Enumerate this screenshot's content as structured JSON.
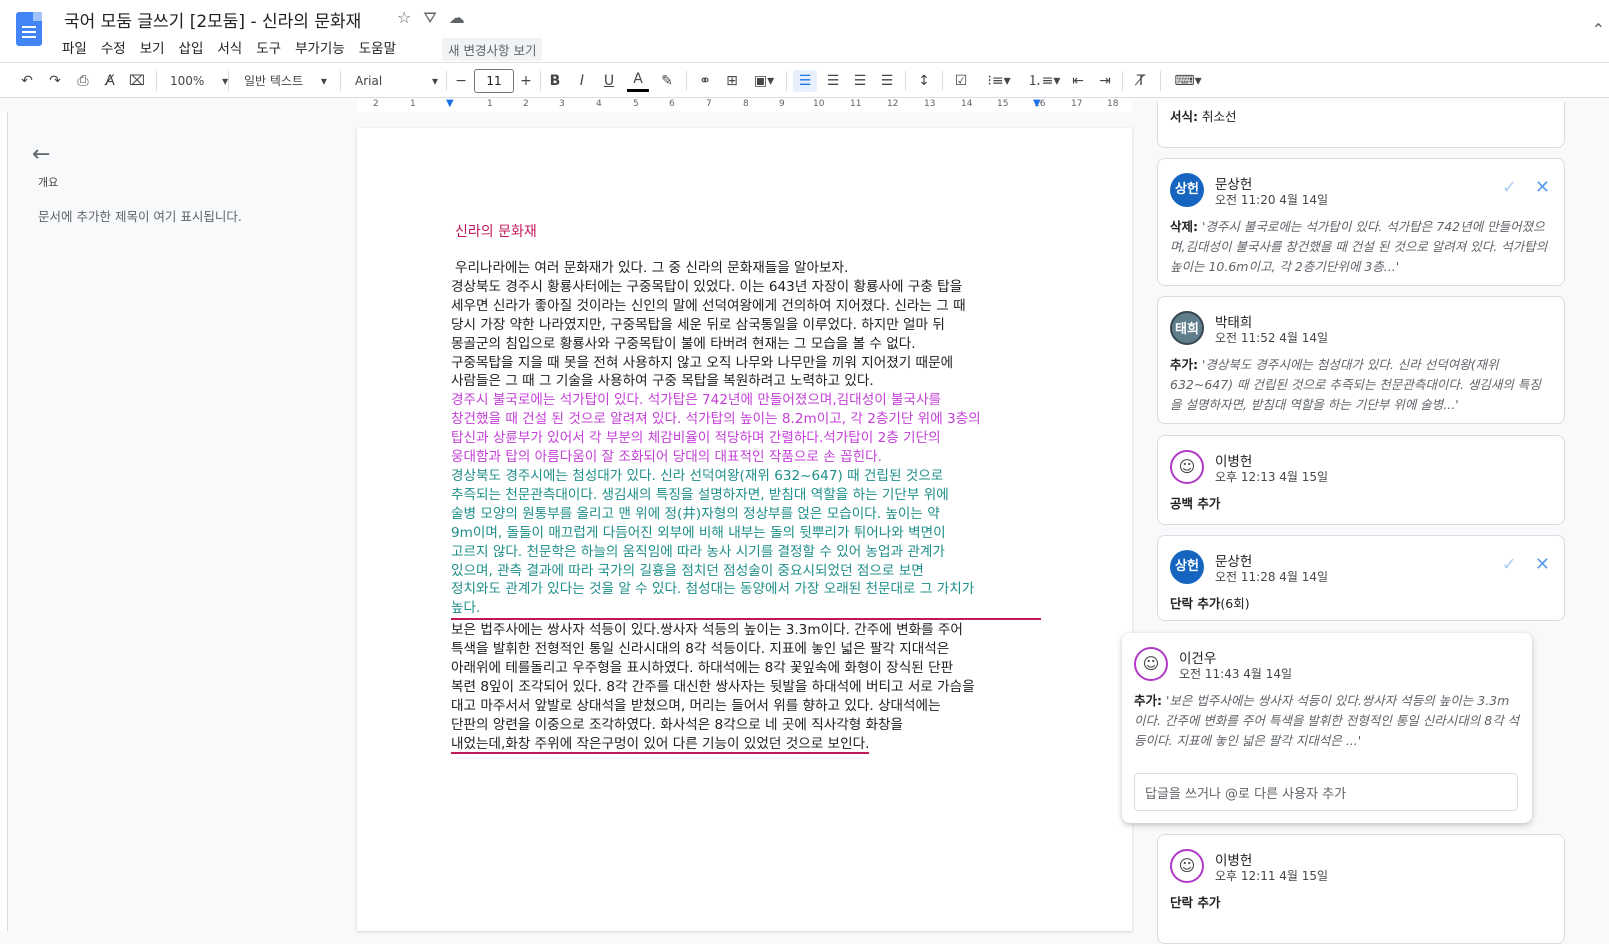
{
  "app": {
    "title": "국어 모둠 글쓰기 [2모둠] - 신라의 문화재",
    "menu": [
      "파일",
      "수정",
      "보기",
      "삽입",
      "서식",
      "도구",
      "부가기능",
      "도움말"
    ],
    "changes_button": "새 변경사항 보기"
  },
  "toolbar": {
    "zoom": "100%",
    "style": "일반 텍스트",
    "font": "Arial",
    "font_size": "11",
    "minus": "−",
    "plus": "+"
  },
  "ruler": [
    "2",
    "1",
    "1",
    "2",
    "3",
    "4",
    "5",
    "6",
    "7",
    "8",
    "9",
    "10",
    "11",
    "12",
    "13",
    "14",
    "15",
    "16",
    "17",
    "18"
  ],
  "outline": {
    "label": "개요",
    "hint": "문서에 추가한 제목이 여기 표시됩니다."
  },
  "document": {
    "title": "신라의 문화재",
    "p1": "우리나라에는 여러 문화재가 있다. 그 중 신라의 문화재들을 알아보자.",
    "p2_lines": [
      " 경상북도 경주시 황룡사터에는 구중목탑이 있었다. 이는 643년 자장이 황룡사에 구충 탑을",
      "세우면 신라가 좋아질 것이라는 신인의 말에 선덕여왕에게 건의하여 지어졌다. 신라는 그 때",
      "당시 가장 약한 나라였지만, 구중목탑을 세운 뒤로 삼국통일을 이루었다. 하지만 얼마 뒤",
      "몽골군의 침입으로 황룡사와 구중목탑이 불에 타버려 현재는 그 모습을 볼 수 없다.",
      "구중목탑을 지을 때 못을 전혀 사용하지 않고 오직 나무와 나무만을 끼워 지어졌기 때문에",
      "사람들은 그 때 그 기술을 사용하여 구중 목탑을 복원하려고 노력하고 있다."
    ],
    "p3_lines": [
      " 경주시 불국로에는 석가탑이 있다. 석가탑은 742년에 만들어졌으며,김대성이 불국사를",
      "창건했을 때 건설 된 것으로 알려져 있다. 석가탑의 높이는 8.2m이고, 각 2층기단 위에 3층의",
      "탑신과 상륜부가 있어서 각 부분의 체감비율이 적당하며 간렬하다.석가탑이 2층 기단의",
      "웅대함과 탑의 아름다움이 잘 조화되어 당대의 대표적인 작품으로 손 꼽힌다."
    ],
    "p4_lines": [
      " 경상북도 경주시에는 첨성대가 있다. 신라 선덕여왕(재위 632~647) 때 건립된 것으로",
      "추즉되는  천문관측대이다. 생김새의 특징을 설명하자면, 받침대 역할을 하는 기단부 위에",
      "술병 모양의 원통부를 올리고 맨 위에 정(井)자형의 정상부를 얹은 모습이다. 높이는 약",
      "9m이며, 돌들이 매끄럽게 다듬어진 외부에 비해 내부는 돌의 뒷뿌리가 튀어나와 벽면이",
      "고르지 않다. 천문학은 하늘의 움직임에 따라 농사 시기를 결정할 수 있어 농업과 관계가",
      "있으며, 관측 결과에 따라 국가의 길흉을 점치던 점성술이 중요시되었던 점으로 보면",
      "정치와도 관계가 있다는 것을 알 수 있다. 첨성대는 동양에서 가장 오래된 천문대로 그 가치가",
      "높다."
    ],
    "p5_lines": [
      " 보은 법주사에는 쌍사자 석등이 있다.쌍사자 석등의 높이는 3.3m이다. 간주에 변화를 주어",
      "특색을 발휘한 전형적인 통일 신라시대의 8각 석등이다. 지표에 놓인 넓은 팔각 지대석은",
      "아래위에 테를돌리고 우주형을 표시하였다. 하대석에는 8각 꽃잎속에 화형이 장식된 단판",
      "복련 8잎이 조각되어 있다. 8각 간주를 대신한 쌍사자는 뒷발을 하대석에 버티고 서로 가슴을",
      "대고 마주서서 앞발로 상대석을 받쳤으며, 머리는 들어서 위를 향하고 있다. 상대석에는",
      "단판의 앙련을 이중으로 조각하였다. 화사석은 8각으로 네 곳에 직사각형 화창을",
      "내었는데,화창 주위에 작은구멍이 있어 다른 기능이 있었던 것으로 보인다."
    ]
  },
  "suggestions": {
    "top_partial": {
      "label": "서식:",
      "text": "취소선"
    },
    "items": [
      {
        "initials": "상헌",
        "color": "#1565c0",
        "name": "문상헌",
        "time": "오전 11:20 4월 14일",
        "kind": "삭제:",
        "text": "'경주시 불국로에는 석가탑이 있다. 석가탑은 742년에 만들어졌으며,김대성이 불국사를 창건했을 때 건설 된 것으로 알려져 있다. 석가탑의 높이는 10.6m이고, 각 2층기단위에 3층...'"
      },
      {
        "initials": "태희",
        "color": "#607d8b",
        "name": "박태희",
        "time": "오전 11:52 4월 14일",
        "kind": "추가:",
        "text": "'경상북도 경주시에는 첨성대가 있다. 신라 선덕여왕(재위 632~647) 때 건립된 것으로 추즉되는 천문관측대이다. 생김새의 특징을 설명하자면, 받침대 역할을 하는 기단부 위에 술병...'"
      },
      {
        "initials": "☺",
        "color": "#ffffff",
        "name": "이병헌",
        "time": "오후 12:13 4월 15일",
        "kind": "공백 추가",
        "text": ""
      },
      {
        "initials": "상헌",
        "color": "#1565c0",
        "name": "문상헌",
        "time": "오전 11:28 4월 14일",
        "kind": "단락 추가",
        "text": "(6회)"
      },
      {
        "initials": "☺",
        "color": "#ffffff",
        "name": "이건우",
        "time": "오전 11:43 4월 14일",
        "kind": "추가:",
        "text": "'보은 법주사에는 쌍사자 석등이 있다.쌍사자 석등의 높이는 3.3m이다. 간주에 변화를 주어 특색을 발휘한 전형적인 통일 신라시대의 8각 석등이다. 지표에 놓인 넓은 팔각 지대석은 ...'",
        "reply_placeholder": "답글을 쓰거나 @로 다른 사용자 추가"
      },
      {
        "initials": "☺",
        "color": "#ffffff",
        "name": "이병헌",
        "time": "오후 12:11 4월 15일",
        "kind": "단락 추가",
        "text": ""
      }
    ]
  },
  "colors": {
    "deleted": "#c33fd6",
    "added": "#1e8e8a",
    "accent": "#1a73e8",
    "title": "#c2185b"
  }
}
